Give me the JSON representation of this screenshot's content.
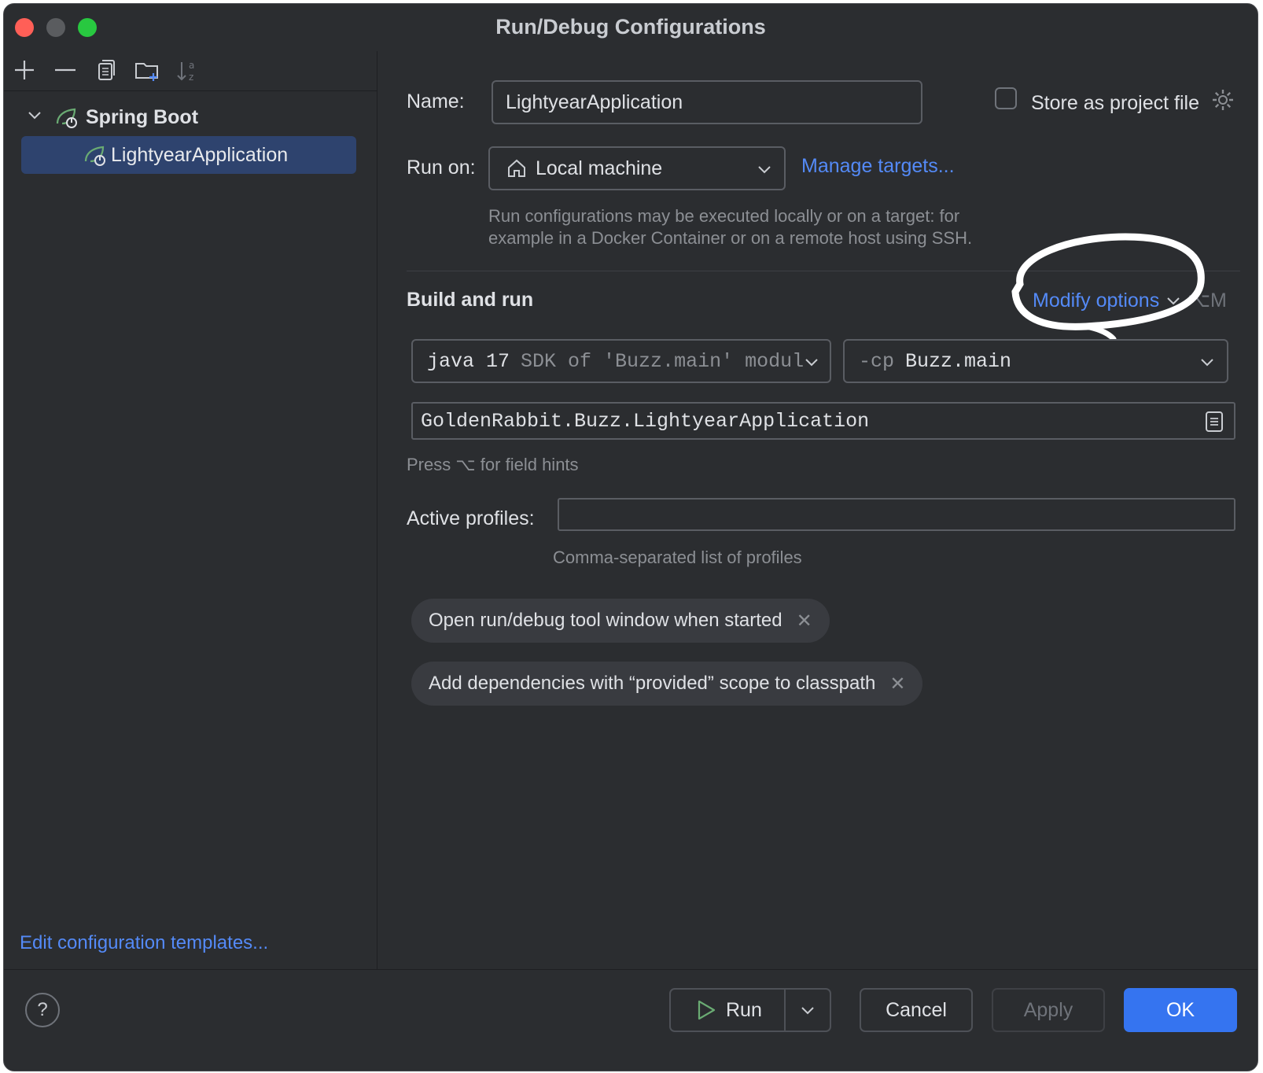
{
  "window": {
    "title": "Run/Debug Configurations"
  },
  "left": {
    "toolbar_icons": [
      "add-icon",
      "remove-icon",
      "copy-icon",
      "new-folder-icon",
      "sort-icon"
    ],
    "tree": {
      "group_label": "Spring Boot",
      "item_label": "LightyearApplication"
    },
    "edit_templates_link": "Edit configuration templates..."
  },
  "form": {
    "name_label": "Name:",
    "name_value": "LightyearApplication",
    "store_as_project_file": "Store as project file",
    "run_on_label": "Run on:",
    "run_on_value": "Local machine",
    "manage_targets": "Manage targets...",
    "run_on_hint_line1": "Run configurations may be executed locally or on a target: for",
    "run_on_hint_line2": "example in a Docker Container or on a remote host using SSH.",
    "build_and_run": "Build and run",
    "modify_options": "Modify options",
    "modify_options_shortcut": "⌥M",
    "sdk_value": "java 17",
    "sdk_detail": "SDK of 'Buzz.main' module",
    "cp_prefix": "-cp",
    "cp_value": "Buzz.main",
    "main_class": "GoldenRabbit.Buzz.LightyearApplication",
    "field_hints": "Press ⌥ for field hints",
    "active_profiles_label": "Active profiles:",
    "active_profiles_value": "",
    "active_profiles_hint": "Comma-separated list of profiles",
    "chips": [
      "Open run/debug tool window when started",
      "Add dependencies with “provided” scope to classpath"
    ]
  },
  "buttons": {
    "help": "?",
    "run": "Run",
    "cancel": "Cancel",
    "apply": "Apply",
    "ok": "OK"
  },
  "colors": {
    "background": "#2b2d30",
    "selection": "#2e436e",
    "link": "#548af7",
    "primary_button": "#3574f0",
    "spring_green": "#6aab73"
  }
}
